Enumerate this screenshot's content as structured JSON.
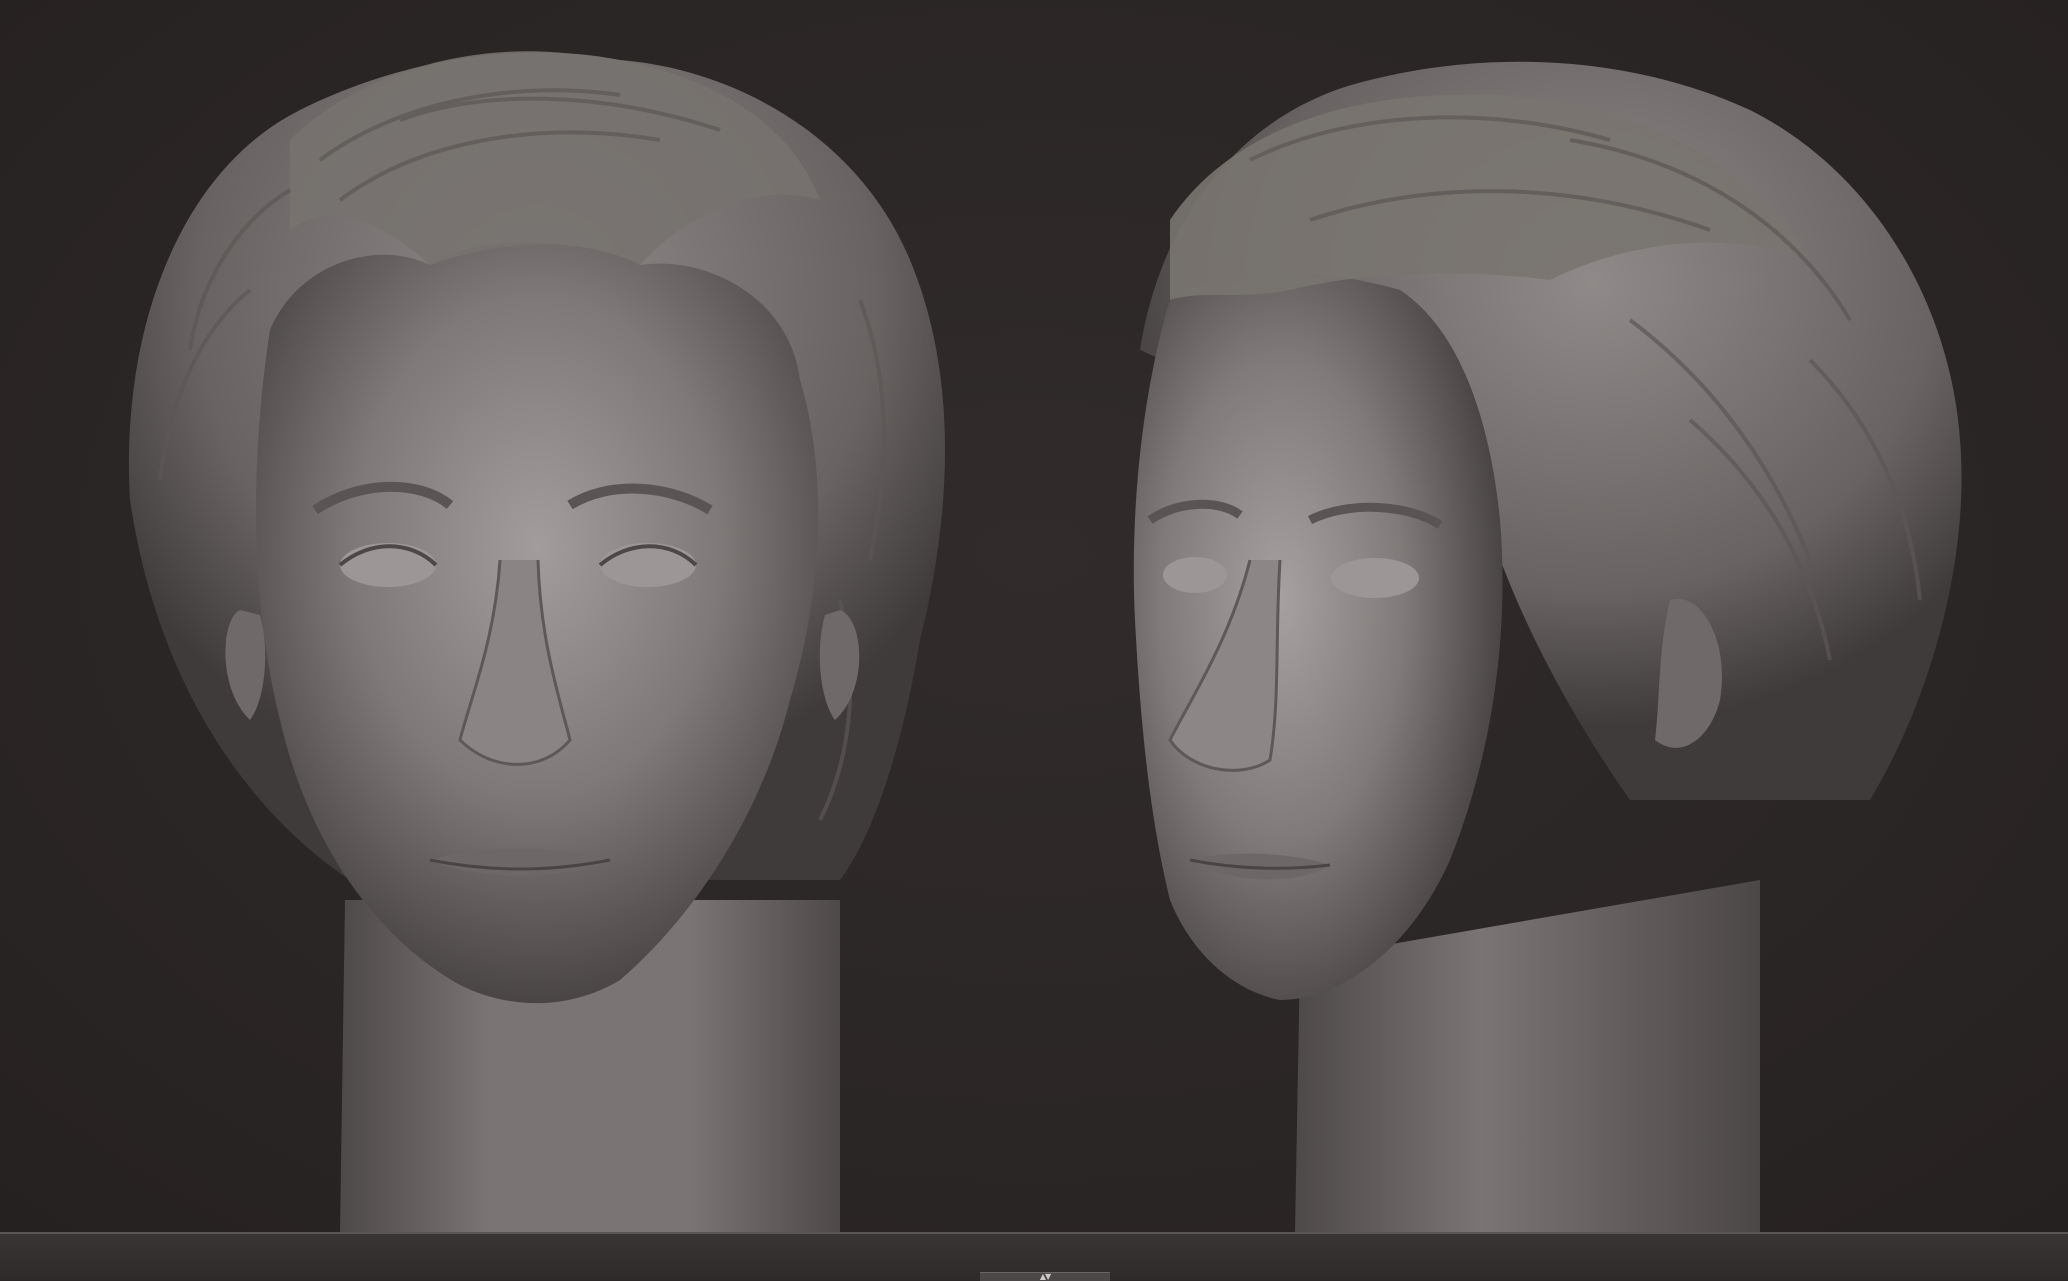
{
  "app": {
    "viewport": {
      "background_color": "#2c2727",
      "model_color": "#7d7877"
    },
    "renders": [
      {
        "view": "front"
      },
      {
        "view": "three-quarter"
      }
    ],
    "bottom_tray": {
      "handle_icon": "up-down-arrows-icon",
      "handle_glyph": "▲▼"
    }
  }
}
